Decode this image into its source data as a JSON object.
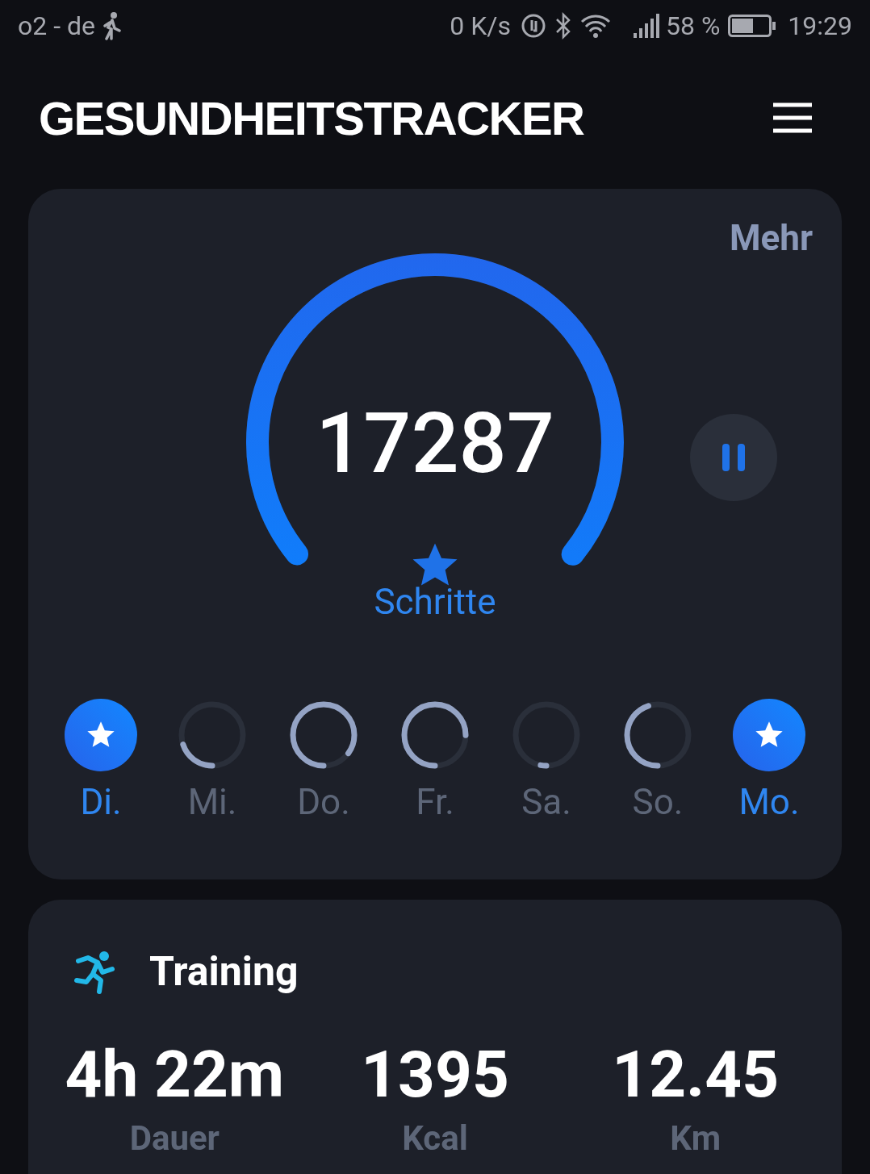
{
  "status_bar": {
    "carrier": "o2 - de",
    "speed": "0 K/s",
    "battery": "58 %",
    "time": "19:29"
  },
  "header": {
    "title": "GESUNDHEITSTRACKER"
  },
  "steps_card": {
    "more": "Mehr",
    "steps": "17287",
    "unit": "Schritte",
    "paused": false,
    "days": [
      {
        "label": "Di.",
        "goal_reached": true
      },
      {
        "label": "Mi.",
        "goal_reached": false
      },
      {
        "label": "Do.",
        "goal_reached": false
      },
      {
        "label": "Fr.",
        "goal_reached": false
      },
      {
        "label": "Sa.",
        "goal_reached": false
      },
      {
        "label": "So.",
        "goal_reached": false
      },
      {
        "label": "Mo.",
        "goal_reached": true
      }
    ]
  },
  "training_card": {
    "title": "Training",
    "stats": [
      {
        "value": "4h 22m",
        "label": "Dauer"
      },
      {
        "value": "1395",
        "label": "Kcal"
      },
      {
        "value": "12.45",
        "label": "Km"
      }
    ]
  }
}
